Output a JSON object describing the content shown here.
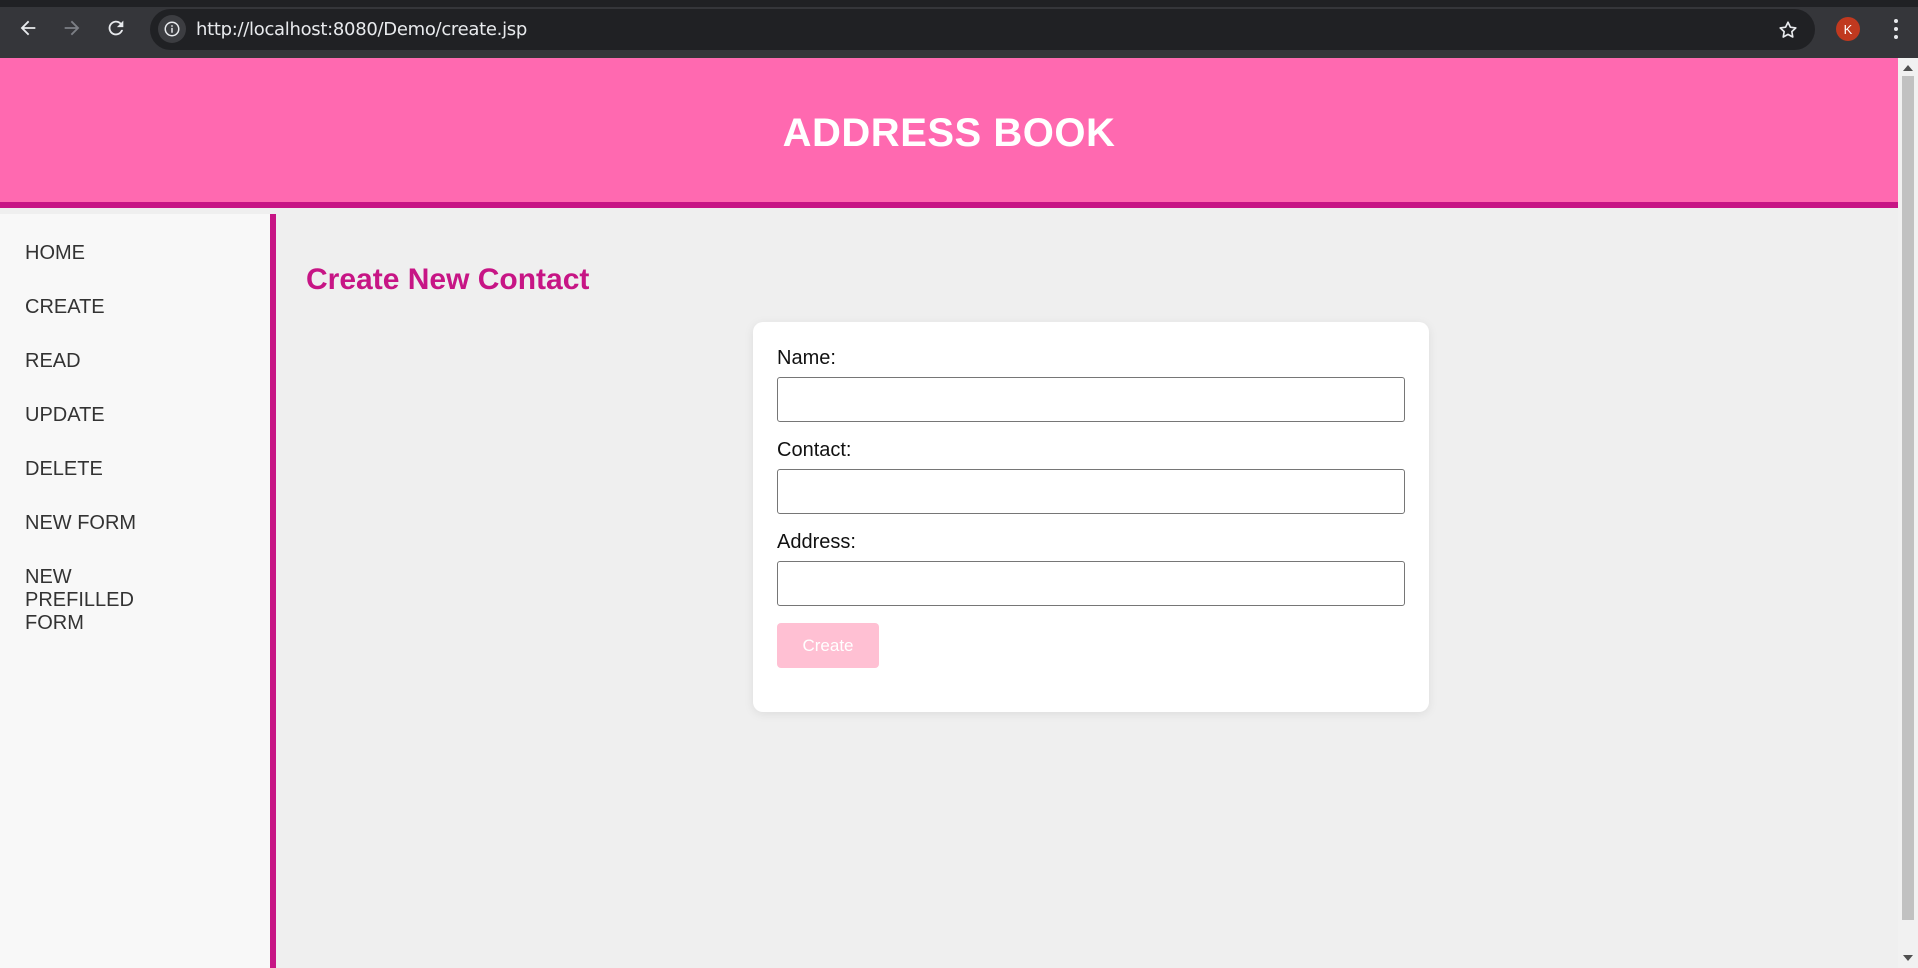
{
  "browser": {
    "url": "http://localhost:8080/Demo/create.jsp",
    "profile_initial": "K",
    "icons": [
      "back-arrow-icon",
      "forward-arrow-icon",
      "reload-icon",
      "info-icon",
      "star-icon",
      "kebab-menu-icon"
    ]
  },
  "header": {
    "title": "ADDRESS BOOK"
  },
  "sidebar": {
    "items": [
      {
        "label": "HOME"
      },
      {
        "label": "CREATE"
      },
      {
        "label": "READ"
      },
      {
        "label": "UPDATE"
      },
      {
        "label": "DELETE"
      },
      {
        "label": "NEW FORM"
      },
      {
        "label": "NEW PREFILLED FORM"
      }
    ]
  },
  "main": {
    "heading": "Create New Contact",
    "form": {
      "name_label": "Name:",
      "name_value": "",
      "contact_label": "Contact:",
      "contact_value": "",
      "address_label": "Address:",
      "address_value": "",
      "submit_label": "Create"
    }
  },
  "colors": {
    "header_bg": "#ff69b0",
    "accent": "#c71585",
    "button_disabled": "#ffc0d3"
  }
}
